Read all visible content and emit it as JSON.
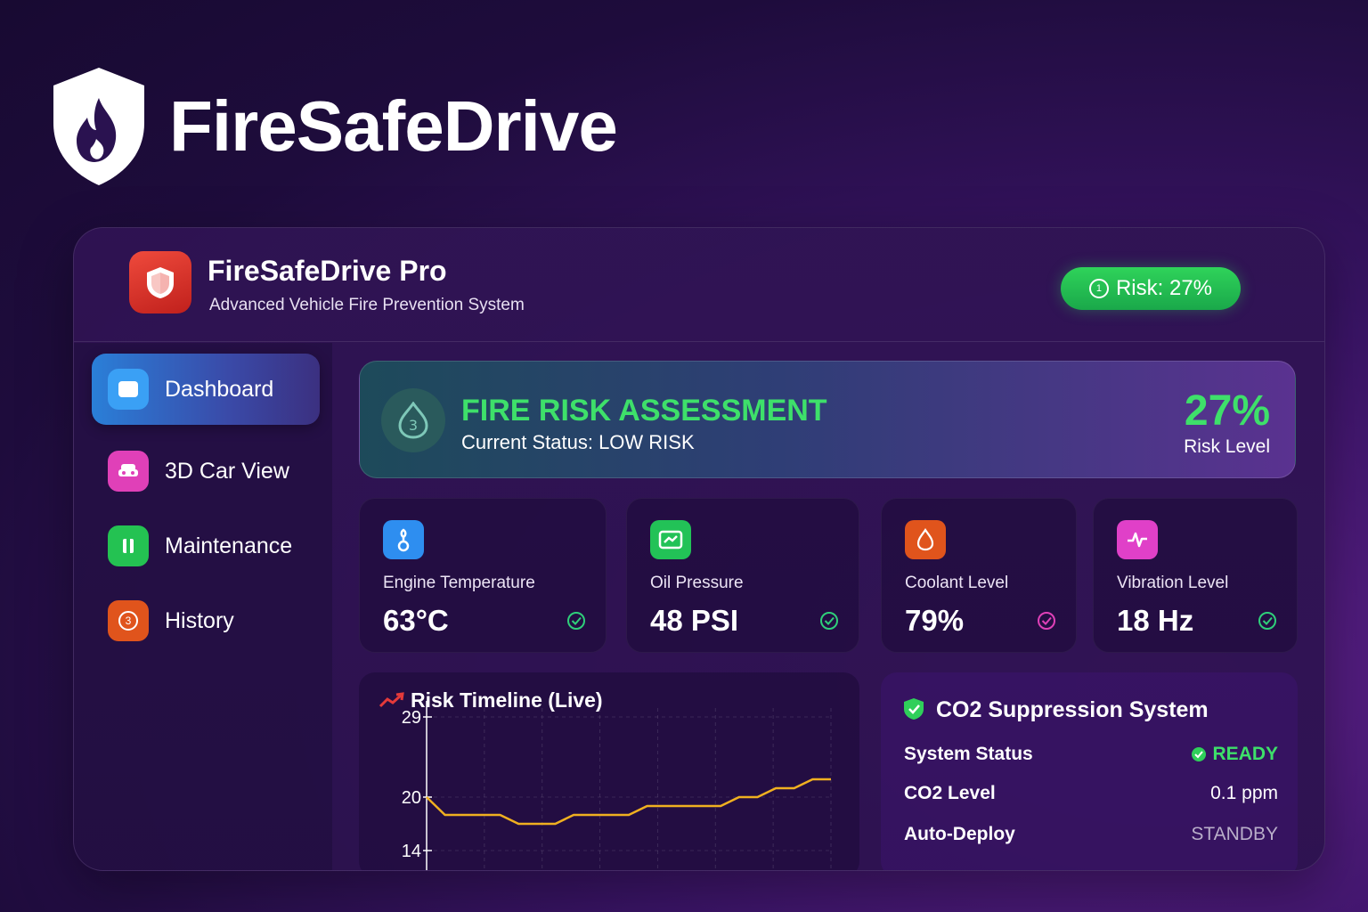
{
  "brand": {
    "title": "FireSafeDrive"
  },
  "header": {
    "app_name": "FireSafeDrive Pro",
    "subtitle": "Advanced Vehicle Fire Prevention System",
    "risk_badge": "Risk: 27%",
    "risk_badge_icon": "1"
  },
  "sidebar": {
    "items": [
      {
        "label": "Dashboard",
        "icon": "dashboard-icon",
        "color": "#3aa0f5",
        "active": true
      },
      {
        "label": "3D Car View",
        "icon": "car-icon",
        "color": "#e040b8",
        "active": false
      },
      {
        "label": "Maintenance",
        "icon": "wrench-icon",
        "color": "#24c252",
        "active": false
      },
      {
        "label": "History",
        "icon": "history-icon",
        "color": "#e0541c",
        "active": false,
        "badge": "3"
      }
    ]
  },
  "assessment": {
    "title": "FIRE RISK ASSESSMENT",
    "status": "Current Status: LOW RISK",
    "value": "27%",
    "value_label": "Risk Level",
    "icon_badge": "3"
  },
  "metrics": [
    {
      "label": "Engine Temperature",
      "value": "63°C",
      "icon": "thermometer-icon",
      "color": "#2e8ef0",
      "check_color": "#2fcf7a"
    },
    {
      "label": "Oil Pressure",
      "value": "48 PSI",
      "icon": "gauge-icon",
      "color": "#22c257",
      "check_color": "#2fcf7a"
    },
    {
      "label": "Coolant Level",
      "value": "79%",
      "icon": "droplet-icon",
      "color": "#e0541c",
      "check_color": "#e040b8"
    },
    {
      "label": "Vibration Level",
      "value": "18 Hz",
      "icon": "pulse-icon",
      "color": "#e040c8",
      "check_color": "#2fcf7a"
    }
  ],
  "timeline": {
    "title": "Risk Timeline (Live)",
    "chart_data": {
      "type": "line",
      "title": "Risk Timeline (Live)",
      "yticks": [
        "29",
        "20",
        "14"
      ],
      "ylim": [
        11,
        30
      ],
      "series": [
        {
          "color": "#f0b020",
          "x": [
            0,
            1,
            2,
            3,
            4,
            5,
            6,
            7,
            8,
            9,
            10,
            11,
            12,
            13,
            14,
            15,
            16,
            17,
            18,
            19,
            20,
            21,
            22
          ],
          "values": [
            20,
            18,
            18,
            18,
            18,
            17,
            17,
            17,
            18,
            18,
            18,
            18,
            19,
            19,
            19,
            19,
            19,
            20,
            20,
            21,
            21,
            22,
            22
          ]
        }
      ]
    }
  },
  "co2": {
    "title": "CO2 Suppression System",
    "rows": [
      {
        "key": "System Status",
        "value": "READY",
        "color": "#3ee06a"
      },
      {
        "key": "CO2 Level",
        "value": "0.1 ppm",
        "color": "#ffffff"
      },
      {
        "key": "Auto-Deploy",
        "value": "STANDBY",
        "color": "#b9aec9"
      }
    ]
  }
}
